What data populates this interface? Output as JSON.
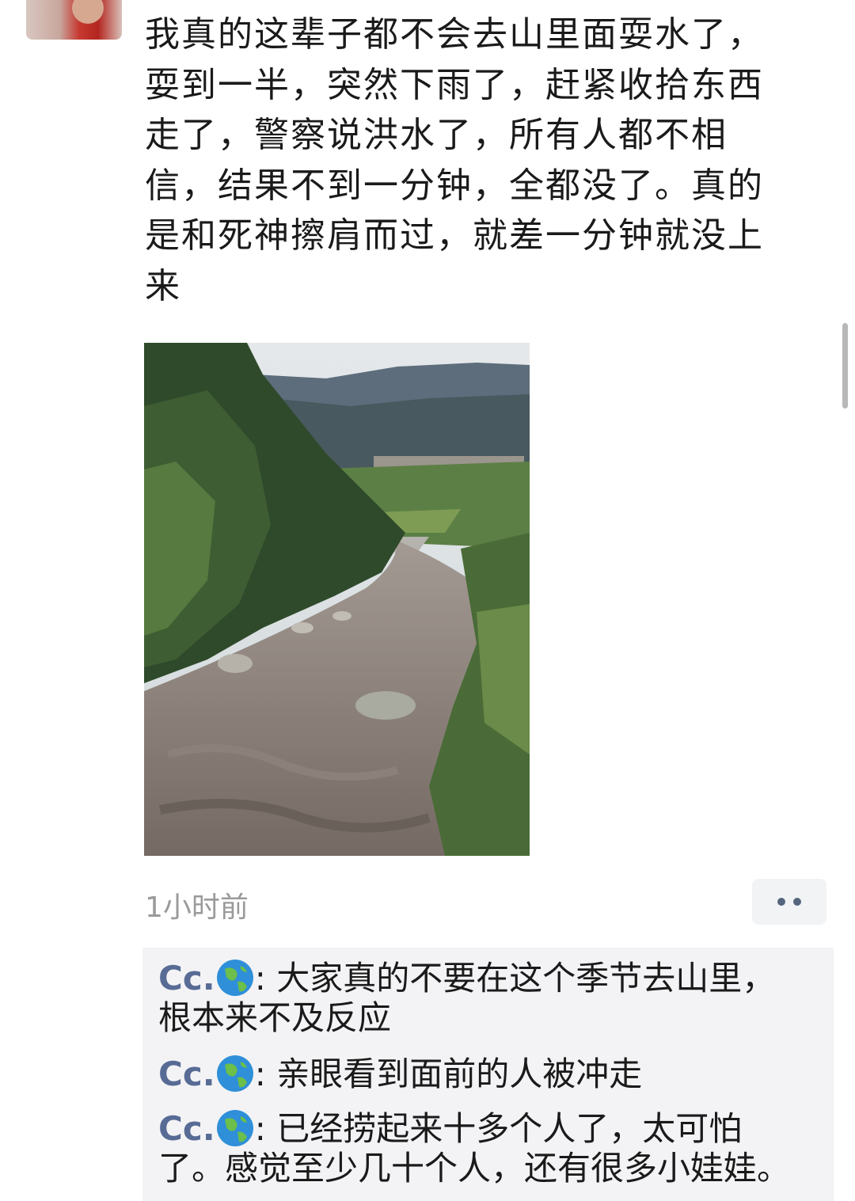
{
  "post": {
    "text": "我真的这辈子都不会去山里面耍水了，\n耍到一半，突然下雨了，赶紧收拾东西\n走了，警察说洪水了，所有人都不相\n信，结果不到一分钟，全都没了。真的\n是和死神擦肩而过，就差一分钟就没上\n来",
    "time": "1小时前"
  },
  "icons": {
    "more": "more-dots-icon",
    "globe": "globe-emoji-icon"
  },
  "comments": [
    {
      "name": "Cc.",
      "sep": ": ",
      "text": "大家真的不要在这个季节去山里，\n根本来不及反应"
    },
    {
      "name": "Cc.",
      "sep": ": ",
      "text": "亲眼看到面前的人被冲走"
    },
    {
      "name": "Cc.",
      "sep": ": ",
      "text": "已经捞起来十多个人了，太可怕\n了。感觉至少几十个人，还有很多小娃娃。"
    }
  ]
}
